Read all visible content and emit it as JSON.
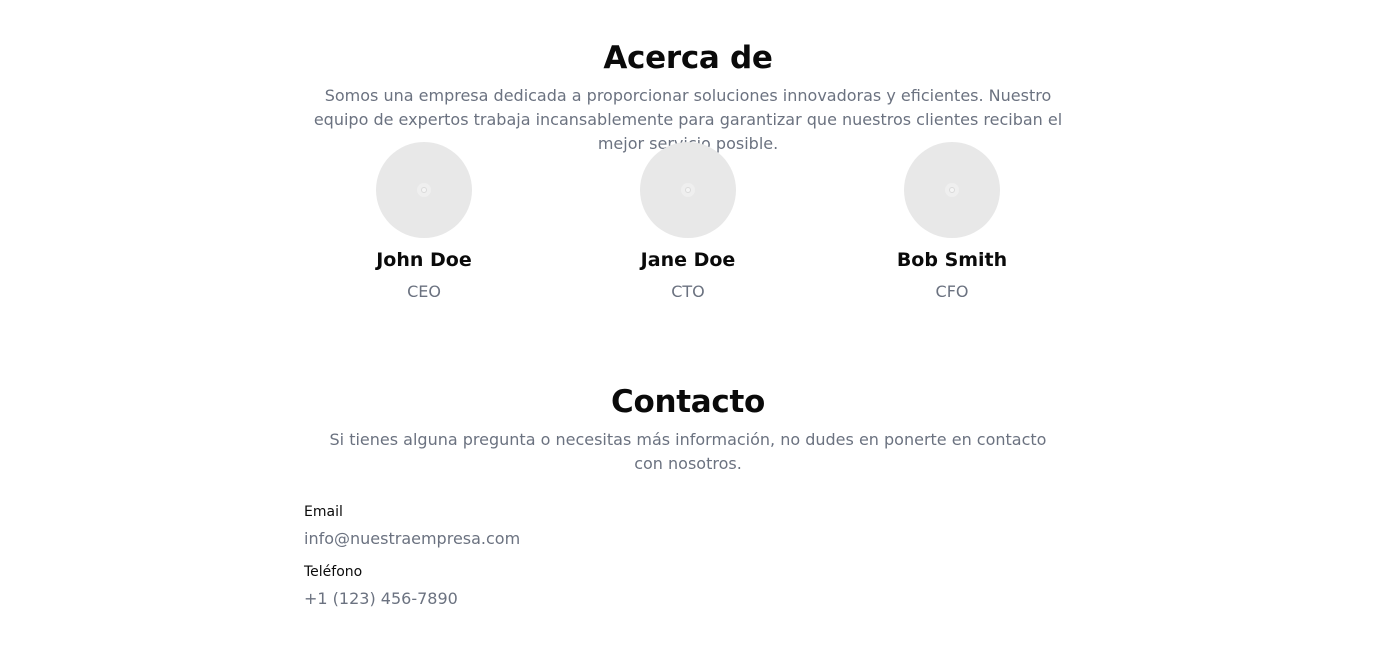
{
  "about": {
    "title": "Acerca de",
    "description": "Somos una empresa dedicada a proporcionar soluciones innovadoras y eficientes. Nuestro equipo de expertos trabaja incansablemente para garantizar que nuestros clientes reciban el mejor servicio posible."
  },
  "team": [
    {
      "name": "John Doe",
      "role": "CEO",
      "avatar_icon": "image-placeholder-icon"
    },
    {
      "name": "Jane Doe",
      "role": "CTO",
      "avatar_icon": "image-placeholder-icon"
    },
    {
      "name": "Bob Smith",
      "role": "CFO",
      "avatar_icon": "image-placeholder-icon"
    }
  ],
  "contact": {
    "title": "Contacto",
    "description": "Si tienes alguna pregunta o necesitas más información, no dudes en ponerte en contacto con nosotros.",
    "email_label": "Email",
    "email_value": "info@nuestraempresa.com",
    "phone_label": "Teléfono",
    "phone_value": "+1 (123) 456-7890"
  },
  "colors": {
    "heading": "#0a0a0a",
    "muted_text": "#6b7280",
    "avatar_bg": "#e8e8e8"
  }
}
